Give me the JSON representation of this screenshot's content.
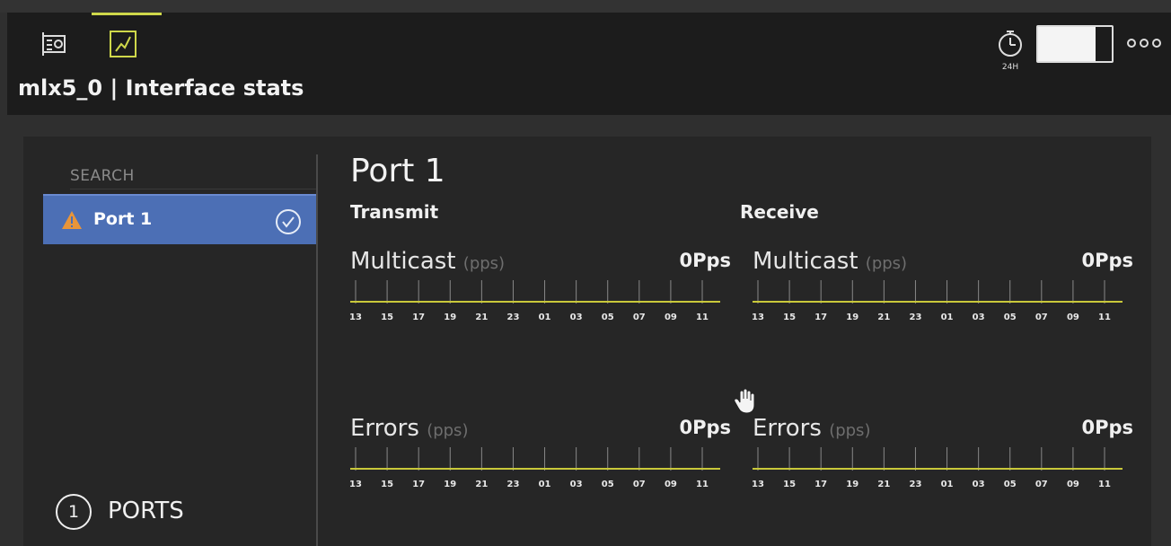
{
  "header": {
    "title": "mlx5_0 | Interface stats",
    "timer_label": "24H",
    "tabs": [
      {
        "icon": "hardware-card-icon",
        "active": false
      },
      {
        "icon": "stats-chart-icon",
        "active": true
      }
    ]
  },
  "sidebar": {
    "search_placeholder": "SEARCH",
    "items": [
      {
        "label": "Port 1",
        "status_icon": "warning-icon",
        "selected": true
      }
    ],
    "ports_count": "1",
    "ports_label": "PORTS"
  },
  "main": {
    "port_title": "Port 1",
    "transmit_label": "Transmit",
    "receive_label": "Receive",
    "charts": [
      {
        "title": "Multicast",
        "unit": "(pps)",
        "value": "0Pps"
      },
      {
        "title": "Multicast",
        "unit": "(pps)",
        "value": "0Pps"
      },
      {
        "title": "Errors",
        "unit": "(pps)",
        "value": "0Pps"
      },
      {
        "title": "Errors",
        "unit": "(pps)",
        "value": "0Pps"
      }
    ]
  },
  "chart_data": [
    {
      "type": "line",
      "title": "Multicast",
      "ylabel": "(pps)",
      "categories": [
        "13",
        "15",
        "17",
        "19",
        "21",
        "23",
        "01",
        "03",
        "05",
        "07",
        "09",
        "11"
      ],
      "series": [
        {
          "values": [
            0,
            0,
            0,
            0,
            0,
            0,
            0,
            0,
            0,
            0,
            0,
            0
          ]
        }
      ]
    },
    {
      "type": "line",
      "title": "Multicast",
      "ylabel": "(pps)",
      "categories": [
        "13",
        "15",
        "17",
        "19",
        "21",
        "23",
        "01",
        "03",
        "05",
        "07",
        "09",
        "11"
      ],
      "series": [
        {
          "values": [
            0,
            0,
            0,
            0,
            0,
            0,
            0,
            0,
            0,
            0,
            0,
            0
          ]
        }
      ]
    },
    {
      "type": "line",
      "title": "Errors",
      "ylabel": "(pps)",
      "categories": [
        "13",
        "15",
        "17",
        "19",
        "21",
        "23",
        "01",
        "03",
        "05",
        "07",
        "09",
        "11"
      ],
      "series": [
        {
          "values": [
            0,
            0,
            0,
            0,
            0,
            0,
            0,
            0,
            0,
            0,
            0,
            0
          ]
        }
      ]
    },
    {
      "type": "line",
      "title": "Errors",
      "ylabel": "(pps)",
      "categories": [
        "13",
        "15",
        "17",
        "19",
        "21",
        "23",
        "01",
        "03",
        "05",
        "07",
        "09",
        "11"
      ],
      "series": [
        {
          "values": [
            0,
            0,
            0,
            0,
            0,
            0,
            0,
            0,
            0,
            0,
            0,
            0
          ]
        }
      ]
    }
  ],
  "colors": {
    "accent": "#cfd84a",
    "line": "#c9c83a",
    "selected_item": "#4c6fb5",
    "warning": "#e8953a",
    "background": "#262626",
    "header": "#1c1c1c"
  }
}
